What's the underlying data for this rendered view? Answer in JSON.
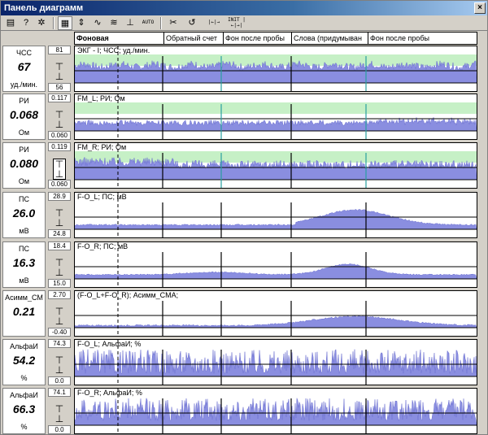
{
  "window": {
    "title": "Панель диаграмм",
    "close_label": "×"
  },
  "toolbar": {
    "auto_label": "AUTO",
    "k1_label": "|←|→",
    "k2_label": "INIT |←|→|"
  },
  "legend": {
    "segments": [
      "Фоновая",
      "Обратный счет",
      "Фон после пробы",
      "Слова (придумыван",
      "Фон после пробы"
    ]
  },
  "colors": {
    "signal": "#8a8ee0",
    "green_band": "#c6f0c6",
    "marker_blue": "#3a3ab0",
    "marker_teal": "#2aa0a0"
  },
  "channels": [
    {
      "name": "ЧСС",
      "value": "67",
      "unit": "уд./мин.",
      "hi": "81",
      "lo": "56",
      "title": "ЭКГ - I; ЧСС; уд./мин."
    },
    {
      "name": "РИ",
      "value": "0.068",
      "unit": "Ом",
      "hi": "0.117",
      "lo": "0.060",
      "title": "FM_L; РИ; Ом"
    },
    {
      "name": "РИ",
      "value": "0.080",
      "unit": "Ом",
      "hi": "0.119",
      "lo": "0.060",
      "title": "FM_R; РИ; Ом"
    },
    {
      "name": "ПС",
      "value": "26.0",
      "unit": "мВ",
      "hi": "28.9",
      "lo": "24.8",
      "title": "F-O_L; ПС; мВ"
    },
    {
      "name": "ПС",
      "value": "16.3",
      "unit": "мВ",
      "hi": "18.4",
      "lo": "15.0",
      "title": "F-O_R; ПС; мВ"
    },
    {
      "name": "Асимм_СМ",
      "value": "0.21",
      "unit": "",
      "hi": "2.70",
      "lo": "-0.40",
      "title": "(F-O_L+F-O_R); Асимм_СМА;"
    },
    {
      "name": "АльфаИ",
      "value": "54.2",
      "unit": "%",
      "hi": "74.3",
      "lo": "0.0",
      "title": "F-O_L; АльфаИ; %"
    },
    {
      "name": "АльфаИ",
      "value": "66.3",
      "unit": "%",
      "hi": "74.1",
      "lo": "0.0",
      "title": "F-O_R; АльфаИ; %"
    }
  ]
}
